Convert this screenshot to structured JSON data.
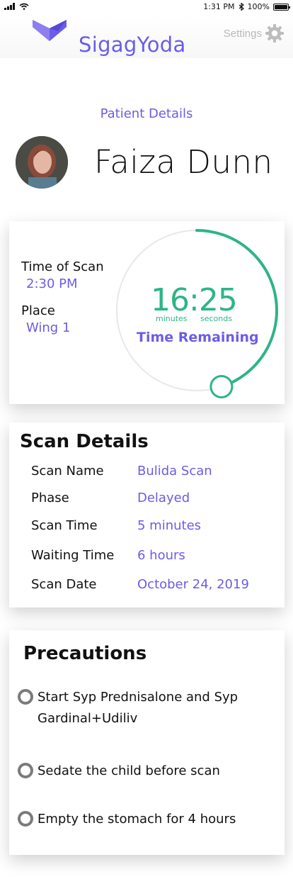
{
  "status_bar": {
    "time": "1:31 PM",
    "battery": "100%"
  },
  "header": {
    "app_title": "SigagYoda",
    "settings_label": "Settings"
  },
  "patient": {
    "section_label": "Patient Details",
    "name": "Faiza Dunn"
  },
  "scan_timer": {
    "time_of_scan_label": "Time of Scan",
    "time_of_scan_value": "2:30 PM",
    "place_label": "Place",
    "place_value": "Wing 1",
    "countdown": "16:25",
    "minutes_unit": "minutes",
    "seconds_unit": "seconds",
    "caption": "Time Remaining",
    "progress_fraction": 0.45,
    "accent_color": "#2db585"
  },
  "scan_details": {
    "heading": "Scan Details",
    "rows": [
      {
        "label": "Scan Name",
        "value": "Bulida Scan"
      },
      {
        "label": "Phase",
        "value": "Delayed"
      },
      {
        "label": "Scan Time",
        "value": "5 minutes"
      },
      {
        "label": "Waiting Time",
        "value": "6 hours"
      },
      {
        "label": "Scan Date",
        "value": "October 24, 2019"
      }
    ]
  },
  "precautions": {
    "heading": "Precautions",
    "items": [
      {
        "text": "Start Syp Prednisalone and Syp Gardinal+Udiliv"
      },
      {
        "text": "Sedate the child before scan"
      },
      {
        "text": "Empty the stomach for 4 hours"
      }
    ]
  },
  "colors": {
    "brand": "#6c5ce7",
    "accent": "#2db585",
    "radio": "#7b7b7b"
  }
}
